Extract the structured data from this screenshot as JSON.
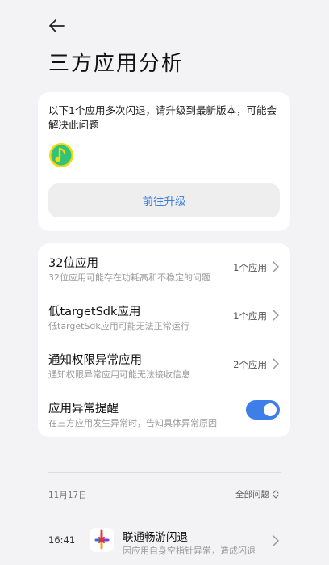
{
  "header": {
    "title": "三方应用分析"
  },
  "upgrade_card": {
    "message": "以下1个应用多次闪退，请升级到最新版本，可能会解决此问题",
    "app_icon": "qq-music-app-icon",
    "button_label": "前往升级"
  },
  "settings": {
    "items": [
      {
        "title": "32位应用",
        "subtitle": "32位应用可能存在功耗高和不稳定的问题",
        "count": "1个应用"
      },
      {
        "title": "低targetSdk应用",
        "subtitle": "低targetSdk应用可能无法正常运行",
        "count": "1个应用"
      },
      {
        "title": "通知权限异常应用",
        "subtitle": "通知权限异常应用可能无法接收信息",
        "count": "2个应用"
      }
    ],
    "toggle_item": {
      "title": "应用异常提醒",
      "subtitle": "在三方应用发生异常时，告知具体异常原因",
      "enabled": true
    }
  },
  "history": {
    "date": "11月17日",
    "filter_label": "全部问题",
    "events": [
      {
        "time": "16:41",
        "title": "联通畅游闪退",
        "subtitle": "因应用自身空指针异常，造成闪退",
        "app_icon": "unicom-app-icon"
      }
    ]
  },
  "colors": {
    "accent": "#3d7ee8",
    "button_text": "#3a7fe0",
    "background": "#f3f3f5",
    "card": "#ffffff"
  }
}
